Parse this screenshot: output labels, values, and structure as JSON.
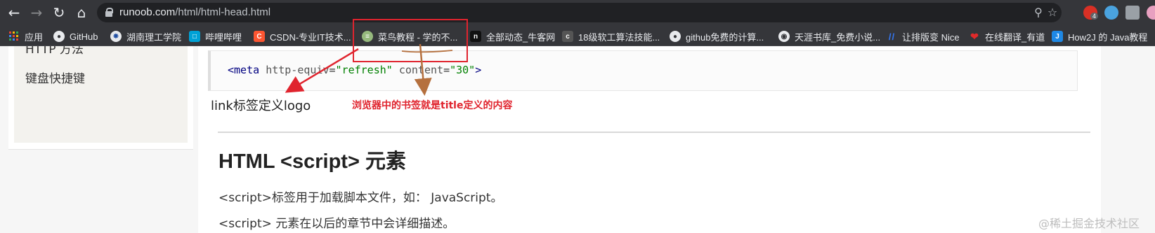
{
  "browser": {
    "url_host": "runoob.com",
    "url_path": "/html/html-head.html",
    "icons": [
      "back-icon",
      "forward-icon",
      "reload-icon",
      "home-icon",
      "lock-icon",
      "zoom-icon",
      "star-icon"
    ],
    "abp_badge": "4"
  },
  "bookmarks": [
    {
      "label": "应用",
      "icon": "apps-icon",
      "color": "#4285f4"
    },
    {
      "label": "GitHub",
      "icon": "github-icon",
      "color": "#2b2b2b"
    },
    {
      "label": "湖南理工学院",
      "icon": "school-icon",
      "color": "#1b4aa0"
    },
    {
      "label": "哔哩哔哩",
      "icon": "bilibili-icon",
      "color": "#00a1d6"
    },
    {
      "label": "CSDN-专业IT技术...",
      "icon": "csdn-icon",
      "color": "#fc5531"
    },
    {
      "label": "菜鸟教程 - 学的不...",
      "icon": "runoob-icon",
      "color": "#96b97d"
    },
    {
      "label": "全部动态_牛客网",
      "icon": "nowcoder-icon",
      "color": "#111111"
    },
    {
      "label": "18级软工算法技能...",
      "icon": "page-icon",
      "color": "#555555"
    },
    {
      "label": "github免费的计算...",
      "icon": "github-icon",
      "color": "#2b2b2b"
    },
    {
      "label": "天涯书库_免费小说...",
      "icon": "globe-icon",
      "color": "#e8eaed"
    },
    {
      "label": "让排版变 Nice",
      "icon": "mdnice-icon",
      "color": "#3478f6"
    },
    {
      "label": "在线翻译_有道",
      "icon": "youdao-icon",
      "color": "#e02a2a"
    },
    {
      "label": "How2J 的 Java教程",
      "icon": "how2j-icon",
      "color": "#1e88e5"
    }
  ],
  "sidebar": {
    "items": [
      "HTTP 方法",
      "键盘快捷键"
    ]
  },
  "code": {
    "open": "<meta",
    "attr1": "http-equiv",
    "eq": "=",
    "val1": "\"refresh\"",
    "attr2": "content",
    "val2": "\"30\"",
    "close": ">"
  },
  "annotations": {
    "logo_note": "link标签定义logo",
    "title_note": "浏览器中的书签就是title定义的内容",
    "arrow_red_color": "#e0242e",
    "arrow_brown_color": "#b5703e"
  },
  "article": {
    "heading": "HTML <script> 元素",
    "p1": "<script>标签用于加载脚本文件，如： JavaScript。",
    "p2": "<script> 元素在以后的章节中会详细描述。"
  },
  "watermark": "@稀土掘金技术社区"
}
